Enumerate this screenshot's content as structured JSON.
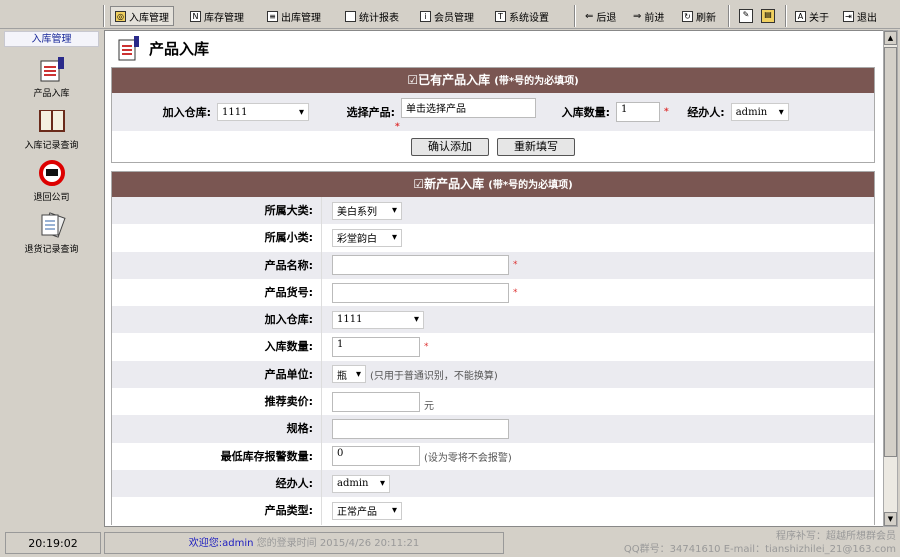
{
  "toolbar": {
    "items": [
      {
        "label": "入库管理",
        "icon": "stock-in-icon"
      },
      {
        "label": "库存管理",
        "icon": "inventory-icon"
      },
      {
        "label": "出库管理",
        "icon": "stock-out-icon"
      },
      {
        "label": "统计报表",
        "icon": "report-icon"
      },
      {
        "label": "会员管理",
        "icon": "member-icon"
      },
      {
        "label": "系统设置",
        "icon": "settings-icon"
      }
    ],
    "back": "后退",
    "forward": "前进",
    "refresh": "刷新",
    "about": "关于",
    "exit": "退出"
  },
  "sidebar": {
    "title": "入库管理",
    "items": [
      {
        "label": "产品入库"
      },
      {
        "label": "入库记录查询"
      },
      {
        "label": "退回公司"
      },
      {
        "label": "退货记录查询"
      }
    ]
  },
  "page": {
    "title": "产品入库"
  },
  "existing": {
    "header": "已有产品入库",
    "note": "(带*号的为必填项)",
    "warehouse_label": "加入仓库:",
    "warehouse": "1111",
    "product_label": "选择产品:",
    "product_value": "单击选择产品",
    "qty_label": "入库数量:",
    "qty": "1",
    "handler_label": "经办人:",
    "handler": "admin",
    "confirm": "确认添加",
    "reset": "重新填写"
  },
  "newproduct": {
    "header": "新产品入库",
    "note": "(带*号的为必填项)",
    "fields": [
      {
        "label": "所属大类:",
        "value": "美白系列"
      },
      {
        "label": "所属小类:",
        "value": "彩堂韵白"
      },
      {
        "label": "产品名称:",
        "value": ""
      },
      {
        "label": "产品货号:",
        "value": ""
      },
      {
        "label": "加入仓库:",
        "value": "1111"
      },
      {
        "label": "入库数量:",
        "value": "1"
      },
      {
        "label": "产品单位:",
        "value": "瓶",
        "hint": "(只用于普通识别，不能换算)"
      },
      {
        "label": "推荐卖价:",
        "value": "",
        "hint": "元"
      },
      {
        "label": "规格:",
        "value": ""
      },
      {
        "label": "最低库存报警数量:",
        "value": "0",
        "hint": "(设为零将不会报警)"
      },
      {
        "label": "经办人:",
        "value": "admin"
      },
      {
        "label": "产品类型:",
        "value": "正常产品"
      }
    ]
  },
  "status": {
    "time": "20:19:02",
    "welcome": "欢迎您:admin",
    "login": "您的登录时间 2015/4/26 20:11:21",
    "author": "程序补写：超越所想群会员",
    "contact": "QQ群号：34741610 E-mail：tianshizhilei_21@163.com"
  }
}
